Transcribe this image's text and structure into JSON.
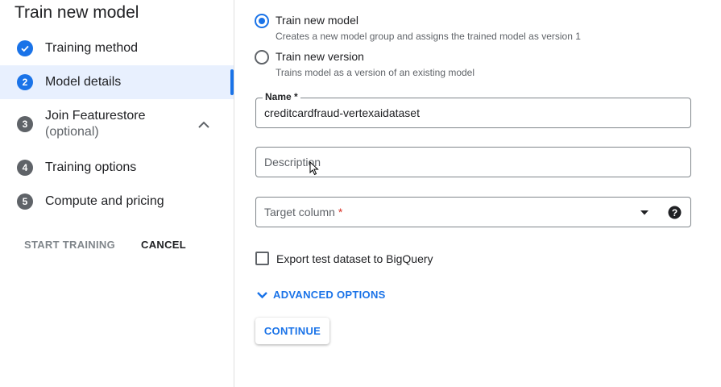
{
  "sidebar": {
    "title": "Train new model",
    "steps": [
      {
        "num": "",
        "label": "Training method",
        "sub": ""
      },
      {
        "num": "2",
        "label": "Model details",
        "sub": ""
      },
      {
        "num": "3",
        "label": "Join Featurestore",
        "sub": "(optional)"
      },
      {
        "num": "4",
        "label": "Training options",
        "sub": ""
      },
      {
        "num": "5",
        "label": "Compute and pricing",
        "sub": ""
      }
    ],
    "start_training": "START TRAINING",
    "cancel": "CANCEL"
  },
  "form": {
    "options": [
      {
        "label": "Train new model",
        "sub": "Creates a new model group and assigns the trained model as version 1",
        "checked": true
      },
      {
        "label": "Train new version",
        "sub": "Trains model as a version of an existing model",
        "checked": false
      }
    ],
    "name_label": "Name *",
    "name_value": "creditcardfraud-vertexaidataset",
    "description_placeholder": "Description",
    "target_column_label": "Target column",
    "required_mark": "*",
    "export_label": "Export test dataset to BigQuery",
    "advanced_label": "ADVANCED OPTIONS",
    "continue_label": "CONTINUE"
  },
  "colors": {
    "accent": "#1a73e8",
    "active_bg": "#e8f0fe",
    "step_gray": "#5f6368",
    "required": "#d93025"
  }
}
